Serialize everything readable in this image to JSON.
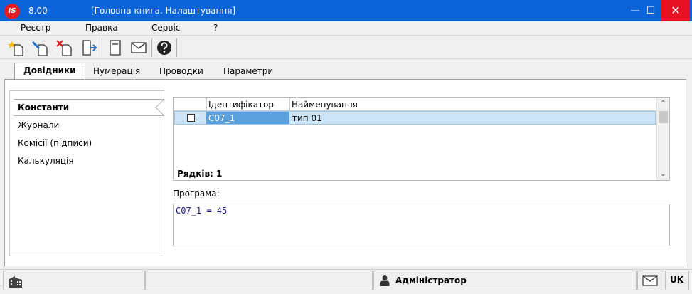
{
  "window": {
    "logo_text": "IS",
    "version": "8.00",
    "title": "[Головна книга. Налаштування]",
    "minimize_glyph": "—",
    "maximize_glyph": "☐",
    "close_glyph": "✕"
  },
  "menu": {
    "items": [
      "Реєстр",
      "Правка",
      "Сервіс",
      "?"
    ]
  },
  "toolbar": {
    "icons": [
      "new-document-icon",
      "edit-document-icon",
      "delete-document-icon",
      "exit-icon",
      "journal-icon",
      "mail-icon",
      "help-icon"
    ]
  },
  "tabs": [
    {
      "label": "Довідники",
      "active": true
    },
    {
      "label": "Нумерація",
      "active": false
    },
    {
      "label": "Проводки",
      "active": false
    },
    {
      "label": "Параметри",
      "active": false
    }
  ],
  "sidebar": {
    "items": [
      {
        "label": "Константи",
        "active": true
      },
      {
        "label": "Журнали",
        "active": false
      },
      {
        "label": "Комісії (підписи)",
        "active": false
      },
      {
        "label": "Калькуляція",
        "active": false
      }
    ]
  },
  "grid": {
    "columns": [
      "Ідентифікатор",
      "Найменування"
    ],
    "rows": [
      {
        "id": "C07_1",
        "name": "тип 01",
        "checked": false
      }
    ],
    "row_count_label": "Рядків: 1"
  },
  "program": {
    "label": "Програма:",
    "text": "C07_1 = 45"
  },
  "status": {
    "user": "Адміністратор",
    "lang": "UK"
  },
  "colors": {
    "titlebar": "#0a64d8",
    "selection": "#cce4f7",
    "close": "#e81123"
  }
}
